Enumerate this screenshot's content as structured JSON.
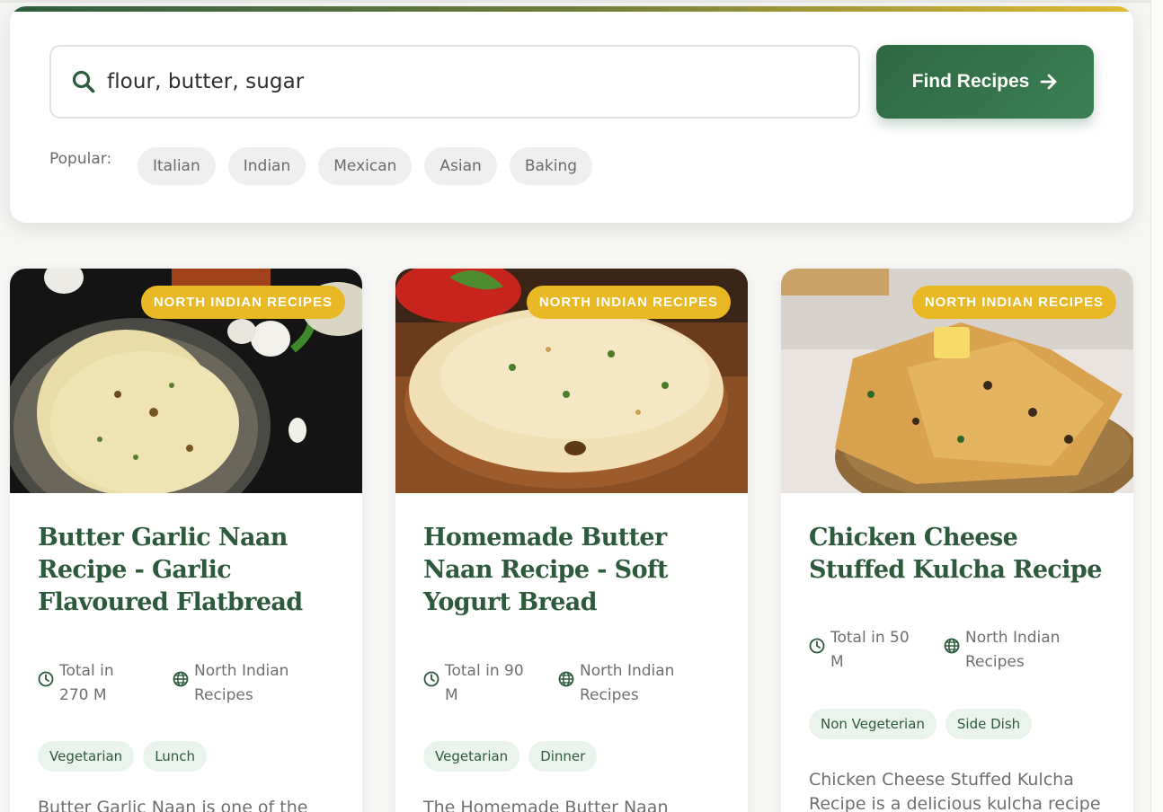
{
  "search": {
    "value": "flour, butter, sugar",
    "button_label": "Find Recipes",
    "popular_label": "Popular:",
    "chips": [
      "Italian",
      "Indian",
      "Mexican",
      "Asian",
      "Baking"
    ]
  },
  "colors": {
    "brand_green": "#2d5a3d",
    "badge_yellow": "#e8b825",
    "tag_bg": "#eaf3ec"
  },
  "icons": {
    "search": "search-icon",
    "arrow": "arrow-right-icon",
    "time": "clock-icon",
    "cuisine": "globe-icon"
  },
  "cards": [
    {
      "badge": "NORTH INDIAN RECIPES",
      "title": "Butter Garlic Naan Recipe - Garlic Flavoured Flatbread",
      "time": "Total in 270 M",
      "cuisine": "North Indian Recipes",
      "tags": [
        "Vegetarian",
        "Lunch"
      ],
      "description": "Butter Garlic Naan is one of the"
    },
    {
      "badge": "NORTH INDIAN RECIPES",
      "title": "Homemade Butter Naan Recipe - Soft Yogurt Bread",
      "time": "Total in 90 M",
      "cuisine": "North Indian Recipes",
      "tags": [
        "Vegetarian",
        "Dinner"
      ],
      "description": "The Homemade Butter Naan"
    },
    {
      "badge": "NORTH INDIAN RECIPES",
      "title": "Chicken Cheese Stuffed Kulcha Recipe",
      "time": "Total in 50 M",
      "cuisine": "North Indian Recipes",
      "tags": [
        "Non Vegeterian",
        "Side Dish"
      ],
      "description": "Chicken Cheese Stuffed Kulcha Recipe is a delicious kulcha recipe"
    }
  ]
}
